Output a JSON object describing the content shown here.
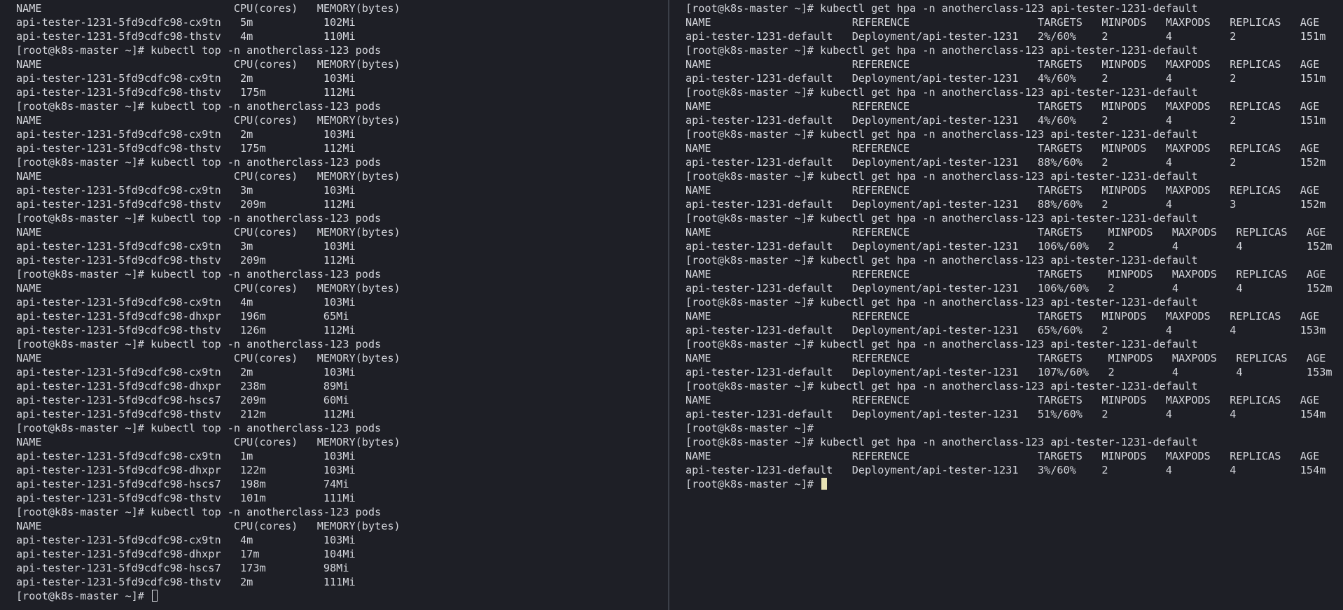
{
  "colors": {
    "background": "#1e1f26",
    "text": "#d4d6dc",
    "divider": "#3b3f48",
    "cursor_block": "#e8e2b4"
  },
  "left_pane": {
    "lines": [
      "NAME                              CPU(cores)   MEMORY(bytes)",
      "api-tester-1231-5fd9cdfc98-cx9tn   5m           102Mi",
      "api-tester-1231-5fd9cdfc98-thstv   4m           110Mi",
      "[root@k8s-master ~]# kubectl top -n anotherclass-123 pods",
      "NAME                              CPU(cores)   MEMORY(bytes)",
      "api-tester-1231-5fd9cdfc98-cx9tn   2m           103Mi",
      "api-tester-1231-5fd9cdfc98-thstv   175m         112Mi",
      "[root@k8s-master ~]# kubectl top -n anotherclass-123 pods",
      "NAME                              CPU(cores)   MEMORY(bytes)",
      "api-tester-1231-5fd9cdfc98-cx9tn   2m           103Mi",
      "api-tester-1231-5fd9cdfc98-thstv   175m         112Mi",
      "[root@k8s-master ~]# kubectl top -n anotherclass-123 pods",
      "NAME                              CPU(cores)   MEMORY(bytes)",
      "api-tester-1231-5fd9cdfc98-cx9tn   3m           103Mi",
      "api-tester-1231-5fd9cdfc98-thstv   209m         112Mi",
      "[root@k8s-master ~]# kubectl top -n anotherclass-123 pods",
      "NAME                              CPU(cores)   MEMORY(bytes)",
      "api-tester-1231-5fd9cdfc98-cx9tn   3m           103Mi",
      "api-tester-1231-5fd9cdfc98-thstv   209m         112Mi",
      "[root@k8s-master ~]# kubectl top -n anotherclass-123 pods",
      "NAME                              CPU(cores)   MEMORY(bytes)",
      "api-tester-1231-5fd9cdfc98-cx9tn   4m           103Mi",
      "api-tester-1231-5fd9cdfc98-dhxpr   196m         65Mi",
      "api-tester-1231-5fd9cdfc98-thstv   126m         112Mi",
      "[root@k8s-master ~]# kubectl top -n anotherclass-123 pods",
      "NAME                              CPU(cores)   MEMORY(bytes)",
      "api-tester-1231-5fd9cdfc98-cx9tn   2m           103Mi",
      "api-tester-1231-5fd9cdfc98-dhxpr   238m         89Mi",
      "api-tester-1231-5fd9cdfc98-hscs7   209m         60Mi",
      "api-tester-1231-5fd9cdfc98-thstv   212m         112Mi",
      "[root@k8s-master ~]# kubectl top -n anotherclass-123 pods",
      "NAME                              CPU(cores)   MEMORY(bytes)",
      "api-tester-1231-5fd9cdfc98-cx9tn   1m           103Mi",
      "api-tester-1231-5fd9cdfc98-dhxpr   122m         103Mi",
      "api-tester-1231-5fd9cdfc98-hscs7   198m         74Mi",
      "api-tester-1231-5fd9cdfc98-thstv   101m         111Mi",
      "[root@k8s-master ~]# kubectl top -n anotherclass-123 pods",
      "NAME                              CPU(cores)   MEMORY(bytes)",
      "api-tester-1231-5fd9cdfc98-cx9tn   4m           103Mi",
      "api-tester-1231-5fd9cdfc98-dhxpr   17m          104Mi",
      "api-tester-1231-5fd9cdfc98-hscs7   173m         98Mi",
      "api-tester-1231-5fd9cdfc98-thstv   2m           111Mi"
    ],
    "prompt": "[root@k8s-master ~]# "
  },
  "right_pane": {
    "lines": [
      "[root@k8s-master ~]# kubectl get hpa -n anotherclass-123 api-tester-1231-default",
      "NAME                      REFERENCE                    TARGETS   MINPODS   MAXPODS   REPLICAS   AGE",
      "api-tester-1231-default   Deployment/api-tester-1231   2%/60%    2         4         2          151m",
      "[root@k8s-master ~]# kubectl get hpa -n anotherclass-123 api-tester-1231-default",
      "NAME                      REFERENCE                    TARGETS   MINPODS   MAXPODS   REPLICAS   AGE",
      "api-tester-1231-default   Deployment/api-tester-1231   4%/60%    2         4         2          151m",
      "[root@k8s-master ~]# kubectl get hpa -n anotherclass-123 api-tester-1231-default",
      "NAME                      REFERENCE                    TARGETS   MINPODS   MAXPODS   REPLICAS   AGE",
      "api-tester-1231-default   Deployment/api-tester-1231   4%/60%    2         4         2          151m",
      "[root@k8s-master ~]# kubectl get hpa -n anotherclass-123 api-tester-1231-default",
      "NAME                      REFERENCE                    TARGETS   MINPODS   MAXPODS   REPLICAS   AGE",
      "api-tester-1231-default   Deployment/api-tester-1231   88%/60%   2         4         2          152m",
      "[root@k8s-master ~]# kubectl get hpa -n anotherclass-123 api-tester-1231-default",
      "NAME                      REFERENCE                    TARGETS   MINPODS   MAXPODS   REPLICAS   AGE",
      "api-tester-1231-default   Deployment/api-tester-1231   88%/60%   2         4         3          152m",
      "[root@k8s-master ~]# kubectl get hpa -n anotherclass-123 api-tester-1231-default",
      "NAME                      REFERENCE                    TARGETS    MINPODS   MAXPODS   REPLICAS   AGE",
      "api-tester-1231-default   Deployment/api-tester-1231   106%/60%   2         4         4          152m",
      "[root@k8s-master ~]# kubectl get hpa -n anotherclass-123 api-tester-1231-default",
      "NAME                      REFERENCE                    TARGETS    MINPODS   MAXPODS   REPLICAS   AGE",
      "api-tester-1231-default   Deployment/api-tester-1231   106%/60%   2         4         4          152m",
      "[root@k8s-master ~]# kubectl get hpa -n anotherclass-123 api-tester-1231-default",
      "NAME                      REFERENCE                    TARGETS   MINPODS   MAXPODS   REPLICAS   AGE",
      "api-tester-1231-default   Deployment/api-tester-1231   65%/60%   2         4         4          153m",
      "[root@k8s-master ~]# kubectl get hpa -n anotherclass-123 api-tester-1231-default",
      "NAME                      REFERENCE                    TARGETS    MINPODS   MAXPODS   REPLICAS   AGE",
      "api-tester-1231-default   Deployment/api-tester-1231   107%/60%   2         4         4          153m",
      "[root@k8s-master ~]# kubectl get hpa -n anotherclass-123 api-tester-1231-default",
      "NAME                      REFERENCE                    TARGETS   MINPODS   MAXPODS   REPLICAS   AGE",
      "api-tester-1231-default   Deployment/api-tester-1231   51%/60%   2         4         4          154m",
      "[root@k8s-master ~]# ",
      "[root@k8s-master ~]# kubectl get hpa -n anotherclass-123 api-tester-1231-default",
      "NAME                      REFERENCE                    TARGETS   MINPODS   MAXPODS   REPLICAS   AGE",
      "api-tester-1231-default   Deployment/api-tester-1231   3%/60%    2         4         4          154m"
    ],
    "prompt": "[root@k8s-master ~]# "
  }
}
